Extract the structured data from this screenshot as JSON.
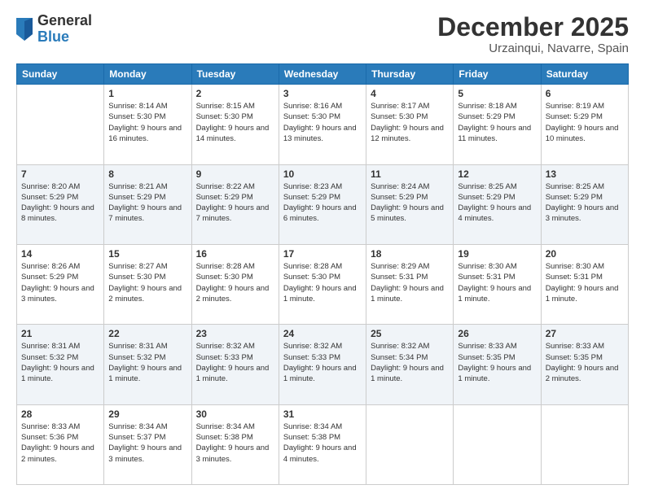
{
  "logo": {
    "general": "General",
    "blue": "Blue"
  },
  "title": "December 2025",
  "location": "Urzainqui, Navarre, Spain",
  "days_of_week": [
    "Sunday",
    "Monday",
    "Tuesday",
    "Wednesday",
    "Thursday",
    "Friday",
    "Saturday"
  ],
  "weeks": [
    [
      {
        "day": "",
        "sunrise": "",
        "sunset": "",
        "daylight": ""
      },
      {
        "day": "1",
        "sunrise": "Sunrise: 8:14 AM",
        "sunset": "Sunset: 5:30 PM",
        "daylight": "Daylight: 9 hours and 16 minutes."
      },
      {
        "day": "2",
        "sunrise": "Sunrise: 8:15 AM",
        "sunset": "Sunset: 5:30 PM",
        "daylight": "Daylight: 9 hours and 14 minutes."
      },
      {
        "day": "3",
        "sunrise": "Sunrise: 8:16 AM",
        "sunset": "Sunset: 5:30 PM",
        "daylight": "Daylight: 9 hours and 13 minutes."
      },
      {
        "day": "4",
        "sunrise": "Sunrise: 8:17 AM",
        "sunset": "Sunset: 5:30 PM",
        "daylight": "Daylight: 9 hours and 12 minutes."
      },
      {
        "day": "5",
        "sunrise": "Sunrise: 8:18 AM",
        "sunset": "Sunset: 5:29 PM",
        "daylight": "Daylight: 9 hours and 11 minutes."
      },
      {
        "day": "6",
        "sunrise": "Sunrise: 8:19 AM",
        "sunset": "Sunset: 5:29 PM",
        "daylight": "Daylight: 9 hours and 10 minutes."
      }
    ],
    [
      {
        "day": "7",
        "sunrise": "Sunrise: 8:20 AM",
        "sunset": "Sunset: 5:29 PM",
        "daylight": "Daylight: 9 hours and 8 minutes."
      },
      {
        "day": "8",
        "sunrise": "Sunrise: 8:21 AM",
        "sunset": "Sunset: 5:29 PM",
        "daylight": "Daylight: 9 hours and 7 minutes."
      },
      {
        "day": "9",
        "sunrise": "Sunrise: 8:22 AM",
        "sunset": "Sunset: 5:29 PM",
        "daylight": "Daylight: 9 hours and 7 minutes."
      },
      {
        "day": "10",
        "sunrise": "Sunrise: 8:23 AM",
        "sunset": "Sunset: 5:29 PM",
        "daylight": "Daylight: 9 hours and 6 minutes."
      },
      {
        "day": "11",
        "sunrise": "Sunrise: 8:24 AM",
        "sunset": "Sunset: 5:29 PM",
        "daylight": "Daylight: 9 hours and 5 minutes."
      },
      {
        "day": "12",
        "sunrise": "Sunrise: 8:25 AM",
        "sunset": "Sunset: 5:29 PM",
        "daylight": "Daylight: 9 hours and 4 minutes."
      },
      {
        "day": "13",
        "sunrise": "Sunrise: 8:25 AM",
        "sunset": "Sunset: 5:29 PM",
        "daylight": "Daylight: 9 hours and 3 minutes."
      }
    ],
    [
      {
        "day": "14",
        "sunrise": "Sunrise: 8:26 AM",
        "sunset": "Sunset: 5:29 PM",
        "daylight": "Daylight: 9 hours and 3 minutes."
      },
      {
        "day": "15",
        "sunrise": "Sunrise: 8:27 AM",
        "sunset": "Sunset: 5:30 PM",
        "daylight": "Daylight: 9 hours and 2 minutes."
      },
      {
        "day": "16",
        "sunrise": "Sunrise: 8:28 AM",
        "sunset": "Sunset: 5:30 PM",
        "daylight": "Daylight: 9 hours and 2 minutes."
      },
      {
        "day": "17",
        "sunrise": "Sunrise: 8:28 AM",
        "sunset": "Sunset: 5:30 PM",
        "daylight": "Daylight: 9 hours and 1 minute."
      },
      {
        "day": "18",
        "sunrise": "Sunrise: 8:29 AM",
        "sunset": "Sunset: 5:31 PM",
        "daylight": "Daylight: 9 hours and 1 minute."
      },
      {
        "day": "19",
        "sunrise": "Sunrise: 8:30 AM",
        "sunset": "Sunset: 5:31 PM",
        "daylight": "Daylight: 9 hours and 1 minute."
      },
      {
        "day": "20",
        "sunrise": "Sunrise: 8:30 AM",
        "sunset": "Sunset: 5:31 PM",
        "daylight": "Daylight: 9 hours and 1 minute."
      }
    ],
    [
      {
        "day": "21",
        "sunrise": "Sunrise: 8:31 AM",
        "sunset": "Sunset: 5:32 PM",
        "daylight": "Daylight: 9 hours and 1 minute."
      },
      {
        "day": "22",
        "sunrise": "Sunrise: 8:31 AM",
        "sunset": "Sunset: 5:32 PM",
        "daylight": "Daylight: 9 hours and 1 minute."
      },
      {
        "day": "23",
        "sunrise": "Sunrise: 8:32 AM",
        "sunset": "Sunset: 5:33 PM",
        "daylight": "Daylight: 9 hours and 1 minute."
      },
      {
        "day": "24",
        "sunrise": "Sunrise: 8:32 AM",
        "sunset": "Sunset: 5:33 PM",
        "daylight": "Daylight: 9 hours and 1 minute."
      },
      {
        "day": "25",
        "sunrise": "Sunrise: 8:32 AM",
        "sunset": "Sunset: 5:34 PM",
        "daylight": "Daylight: 9 hours and 1 minute."
      },
      {
        "day": "26",
        "sunrise": "Sunrise: 8:33 AM",
        "sunset": "Sunset: 5:35 PM",
        "daylight": "Daylight: 9 hours and 1 minute."
      },
      {
        "day": "27",
        "sunrise": "Sunrise: 8:33 AM",
        "sunset": "Sunset: 5:35 PM",
        "daylight": "Daylight: 9 hours and 2 minutes."
      }
    ],
    [
      {
        "day": "28",
        "sunrise": "Sunrise: 8:33 AM",
        "sunset": "Sunset: 5:36 PM",
        "daylight": "Daylight: 9 hours and 2 minutes."
      },
      {
        "day": "29",
        "sunrise": "Sunrise: 8:34 AM",
        "sunset": "Sunset: 5:37 PM",
        "daylight": "Daylight: 9 hours and 3 minutes."
      },
      {
        "day": "30",
        "sunrise": "Sunrise: 8:34 AM",
        "sunset": "Sunset: 5:38 PM",
        "daylight": "Daylight: 9 hours and 3 minutes."
      },
      {
        "day": "31",
        "sunrise": "Sunrise: 8:34 AM",
        "sunset": "Sunset: 5:38 PM",
        "daylight": "Daylight: 9 hours and 4 minutes."
      },
      {
        "day": "",
        "sunrise": "",
        "sunset": "",
        "daylight": ""
      },
      {
        "day": "",
        "sunrise": "",
        "sunset": "",
        "daylight": ""
      },
      {
        "day": "",
        "sunrise": "",
        "sunset": "",
        "daylight": ""
      }
    ]
  ]
}
